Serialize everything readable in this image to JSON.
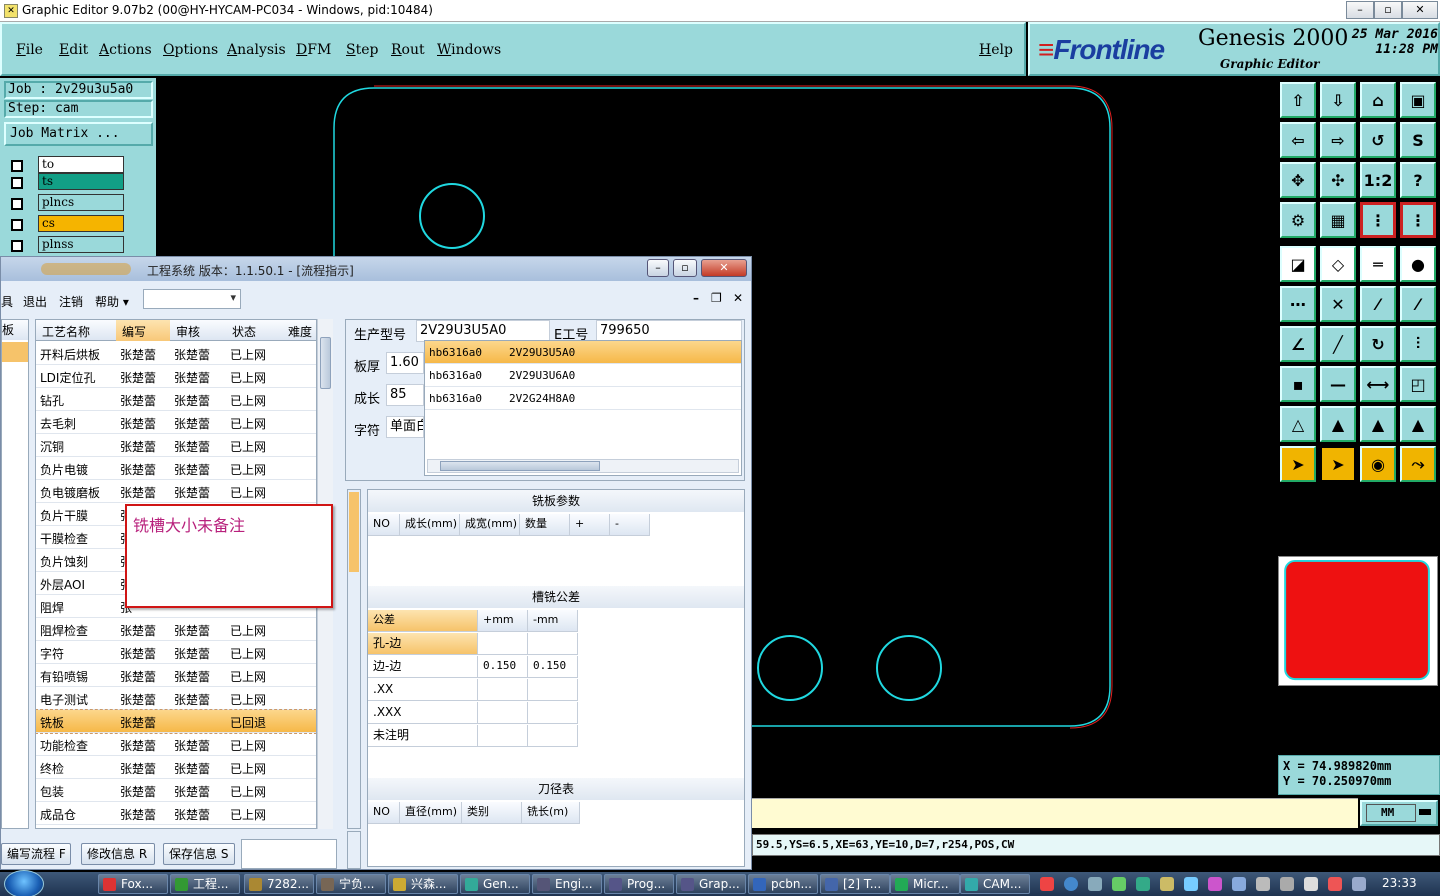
{
  "window": {
    "title": "Graphic Editor 9.07b2 (00@HY-HYCAM-PC034 - Windows, pid:10484)"
  },
  "menu": [
    "File",
    "Edit",
    "Actions",
    "Options",
    "Analysis",
    "DFM",
    "Step",
    "Rout",
    "Windows"
  ],
  "help_label": "Help",
  "brand": {
    "logo": "Frontline",
    "product": "Genesis 2000",
    "subtitle": "Graphic Editor",
    "date": "25 Mar 2016",
    "time": "11:28 PM"
  },
  "job": {
    "job_line": "Job : 2v29u3u5a0",
    "step_line": "Step: cam",
    "matrix_label": "Job Matrix ..."
  },
  "layers": [
    {
      "name": "to",
      "color": "#ffffff"
    },
    {
      "name": "ts",
      "color": "#129f86"
    },
    {
      "name": "plncs",
      "color": "#9ad9da"
    },
    {
      "name": "cs",
      "color": "#f5b400"
    },
    {
      "name": "plnss",
      "color": "#9ad9da"
    }
  ],
  "coords": {
    "x": "X = 74.989820mm",
    "y": "Y = 70.250970mm"
  },
  "units": "MM",
  "command_line": "59.5,YS=6.5,XE=63,YE=10,D=7,r254,POS,CW",
  "eng": {
    "title": "工程系统 版本：1.1.50.1 - [流程指示]",
    "menu": [
      "具",
      "退出",
      "注销",
      "帮助 ▾"
    ],
    "leftstrip_header": "板",
    "columns": [
      "工艺名称",
      "编写",
      "审核",
      "状态",
      "难度"
    ],
    "rows": [
      [
        "开料后烘板",
        "张楚蕾",
        "张楚蕾",
        "已上网"
      ],
      [
        "LDI定位孔",
        "张楚蕾",
        "张楚蕾",
        "已上网"
      ],
      [
        "钻孔",
        "张楚蕾",
        "张楚蕾",
        "已上网"
      ],
      [
        "去毛刺",
        "张楚蕾",
        "张楚蕾",
        "已上网"
      ],
      [
        "沉铜",
        "张楚蕾",
        "张楚蕾",
        "已上网"
      ],
      [
        "负片电镀",
        "张楚蕾",
        "张楚蕾",
        "已上网"
      ],
      [
        "负电镀磨板",
        "张楚蕾",
        "张楚蕾",
        "已上网"
      ],
      [
        "负片干膜",
        "张",
        "",
        ""
      ],
      [
        "干膜检查",
        "张",
        "",
        ""
      ],
      [
        "负片蚀刻",
        "张",
        "",
        ""
      ],
      [
        "外层AOI",
        "张",
        "",
        ""
      ],
      [
        "阻焊",
        "张",
        "",
        ""
      ],
      [
        "阻焊检查",
        "张楚蕾",
        "张楚蕾",
        "已上网"
      ],
      [
        "字符",
        "张楚蕾",
        "张楚蕾",
        "已上网"
      ],
      [
        "有铅喷锡",
        "张楚蕾",
        "张楚蕾",
        "已上网"
      ],
      [
        "电子测试",
        "张楚蕾",
        "张楚蕾",
        "已上网"
      ],
      [
        "铣板",
        "张楚蕾",
        "",
        "已回退"
      ],
      [
        "功能检查",
        "张楚蕾",
        "张楚蕾",
        "已上网"
      ],
      [
        "终检",
        "张楚蕾",
        "张楚蕾",
        "已上网"
      ],
      [
        "包装",
        "张楚蕾",
        "张楚蕾",
        "已上网"
      ],
      [
        "成品仓",
        "张楚蕾",
        "张楚蕾",
        "已上网"
      ]
    ],
    "selected_row": 16,
    "note": "铣槽大小未备注",
    "info": {
      "model_label": "生产型号",
      "model_value": "2V29U3U5A0",
      "eno_label": "E工号",
      "eno_value": "799650",
      "thickness_label": "板厚",
      "thickness_value": "1.60",
      "length_label": "成长",
      "length_value": "85",
      "char_label": "字符",
      "char_value": "单面白"
    },
    "subgrid": [
      [
        "hb6316a0",
        "2V29U3U5A0"
      ],
      [
        "hb6316a0",
        "2V29U3U6A0"
      ],
      [
        "hb6316a0",
        "2V2G24H8A0"
      ]
    ],
    "milling": {
      "title": "铣板参数",
      "columns": [
        "NO",
        "成长(mm)",
        "成宽(mm)",
        "数量",
        "+",
        "-"
      ]
    },
    "tolerance": {
      "title": "槽铣公差",
      "columns": [
        "公差",
        "+mm",
        "-mm"
      ],
      "rows": [
        [
          "孔-边",
          "",
          ""
        ],
        [
          "边-边",
          "0.150",
          "0.150"
        ],
        [
          ".XX",
          "",
          ""
        ],
        [
          ".XXX",
          "",
          ""
        ],
        [
          "未注明",
          "",
          ""
        ]
      ]
    },
    "tools": {
      "title": "刀径表",
      "columns": [
        "NO",
        "直径(mm)",
        "类别",
        "铣长(m)"
      ]
    },
    "buttons": [
      "编写流程 F",
      "修改信息 R",
      "保存信息 S"
    ]
  },
  "taskbar": {
    "items": [
      "Fox...",
      "工程...",
      "7282...",
      "宁负...",
      "兴森...",
      "Gen...",
      "Engi...",
      "Prog...",
      "Grap...",
      "pcbn...",
      "[2] T...",
      "Micr...",
      "CAM..."
    ],
    "clock": "23:33"
  },
  "colors": {
    "panel": "#9ad9da",
    "outline_cyan": "#20d8e0",
    "outline_red": "#e02020",
    "accent_orange": "#f6b848"
  }
}
